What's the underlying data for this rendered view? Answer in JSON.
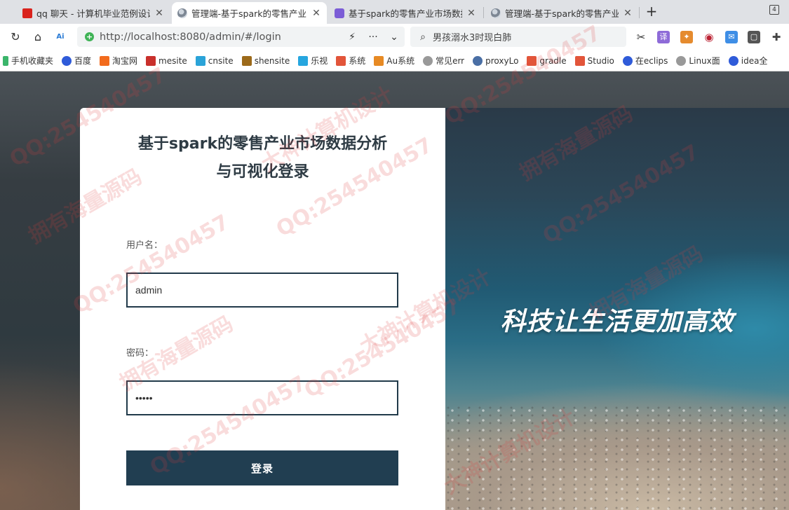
{
  "browser": {
    "tabs": [
      {
        "title": "qq 聊天 - 计算机毕业范例设计",
        "active": false
      },
      {
        "title": "管理端-基于spark的零售产业",
        "active": true
      },
      {
        "title": "基于spark的零售产业市场数据",
        "active": false
      },
      {
        "title": "管理端-基于spark的零售产业",
        "active": false
      }
    ],
    "new_tab": "+",
    "tab_count": "4",
    "address_url": "http://localhost:8080/admin/#/login",
    "search_text": "男孩溺水3时现白肺",
    "bookmarks": [
      "手机收藏夹",
      "百度",
      "淘宝网",
      "mesite",
      "cnsite",
      "shensite",
      "乐视",
      "系统",
      "Au系统",
      "常见err",
      "proxyLo",
      "gradle",
      "Studio",
      "在eclips",
      "Linux面",
      "idea全"
    ]
  },
  "login": {
    "title_line1": "基于spark的零售产业市场数据分析",
    "title_line2": "与可视化登录",
    "username_label": "用户名：",
    "username_value": "admin",
    "password_label": "密码：",
    "password_value": "•••••",
    "login_button": "登录"
  },
  "banner": {
    "slogan": "科技让生活更加高效"
  },
  "watermarks": [
    "QQ:254540457",
    "大神计算机设计",
    "拥有海量源码"
  ],
  "colors": {
    "button_bg": "#213e51",
    "input_border": "#213a4a",
    "title_color": "#2e3b44"
  }
}
